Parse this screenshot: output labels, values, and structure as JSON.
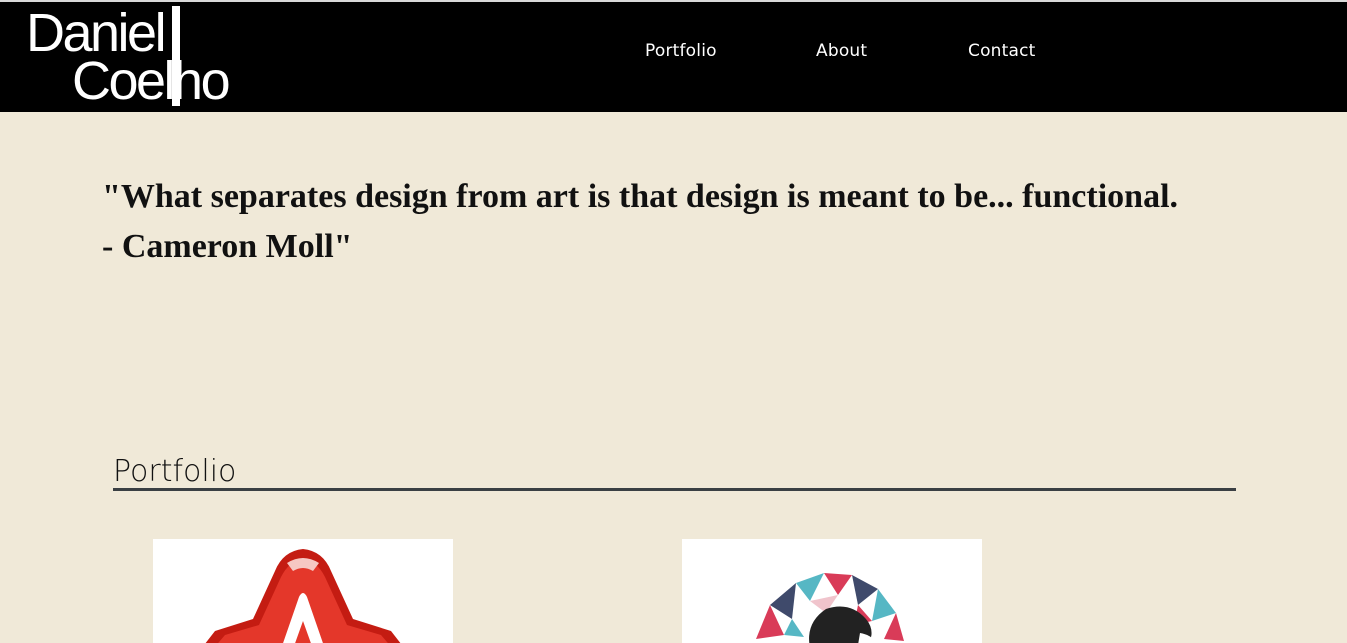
{
  "header": {
    "logo_first": "Daniel",
    "logo_last": "Coelho",
    "nav": {
      "portfolio": "Portfolio",
      "about": "About",
      "contact": "Contact"
    }
  },
  "hero": {
    "quote_line1": "\"What separates design from art is that design is meant to be... functional.",
    "quote_line2": "- Cameron Moll\""
  },
  "portfolio": {
    "title": "Portfolio",
    "items": [
      {
        "icon": "red-a-logo-thumbnail"
      },
      {
        "icon": "geometric-portrait-logo-thumbnail"
      }
    ]
  },
  "colors": {
    "background": "#f0e9d8",
    "header": "#000000",
    "rule": "#3a3f43",
    "accent_red": "#d62b1f"
  }
}
